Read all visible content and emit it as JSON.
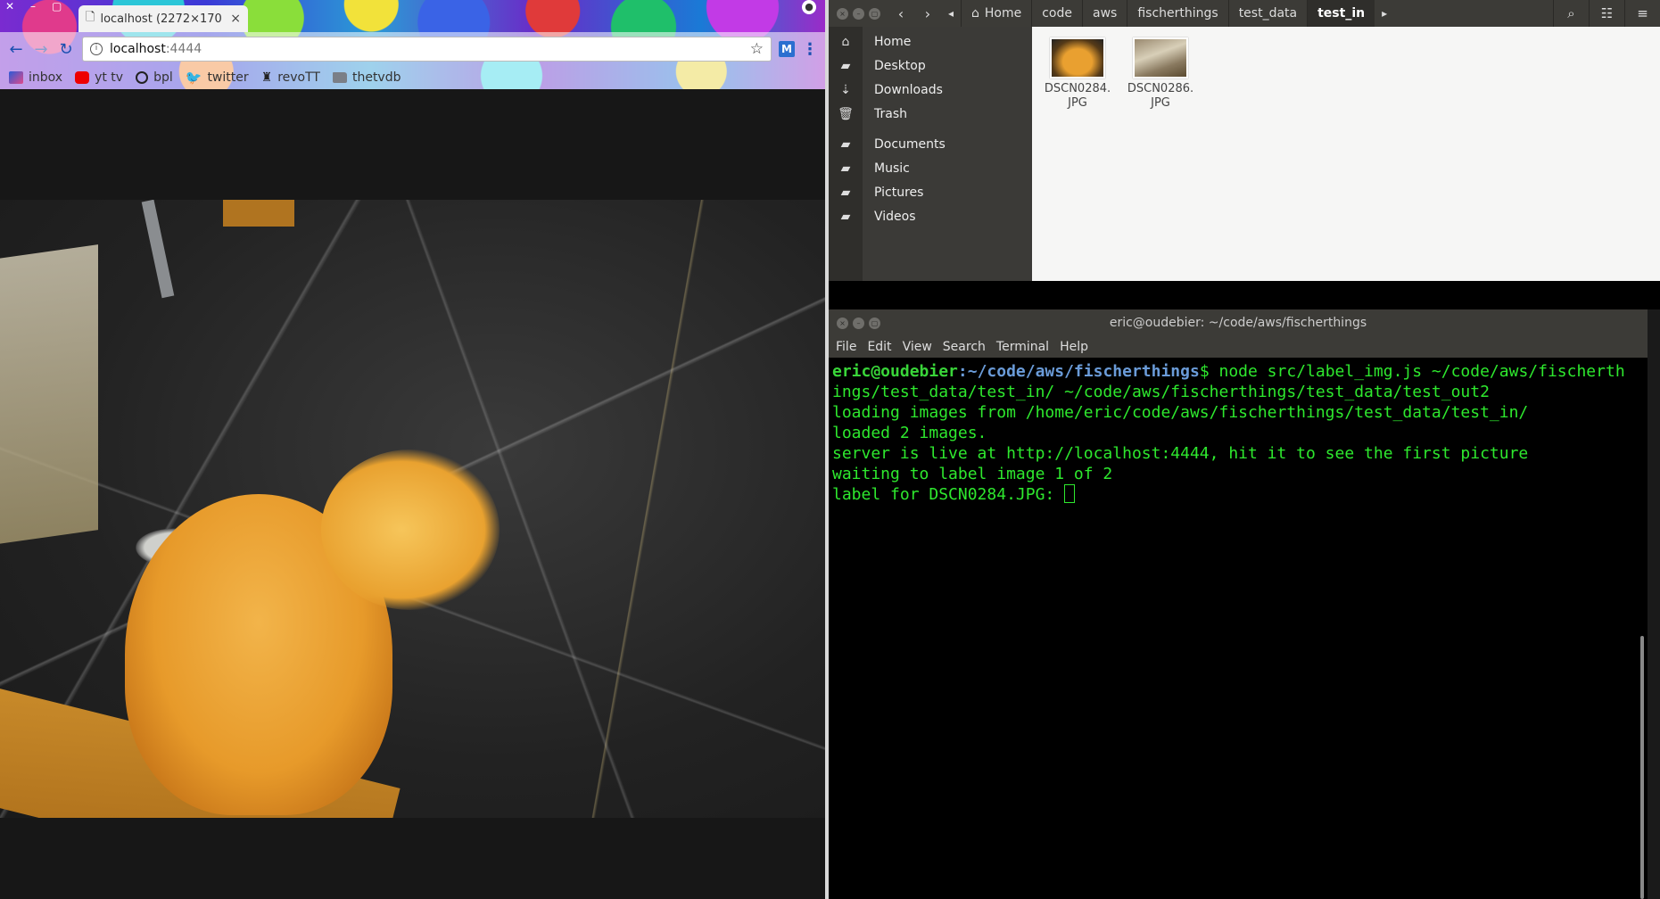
{
  "chrome": {
    "tab_title": "localhost (2272×170",
    "tab_close": "×",
    "url_host": "localhost",
    "url_port": ":4444",
    "extension_letter": "M",
    "bookmarks": [
      {
        "label": "inbox",
        "icon": "inbox-icon"
      },
      {
        "label": "yt tv",
        "icon": "youtube-icon"
      },
      {
        "label": "bpl",
        "icon": "circle-icon"
      },
      {
        "label": "twitter",
        "icon": "twitter-bird-icon"
      },
      {
        "label": "revoTT",
        "icon": "robot-icon"
      },
      {
        "label": "thetvdb",
        "icon": "folder-icon"
      }
    ]
  },
  "files": {
    "breadcrumbs": [
      "Home",
      "code",
      "aws",
      "fischerthings",
      "test_data",
      "test_in"
    ],
    "sidebar": [
      {
        "label": "Home",
        "icon": "home-icon"
      },
      {
        "label": "Desktop",
        "icon": "folder-icon"
      },
      {
        "label": "Downloads",
        "icon": "download-icon"
      },
      {
        "label": "Trash",
        "icon": "trash-icon"
      },
      {
        "label": "Documents",
        "icon": "folder-icon"
      },
      {
        "label": "Music",
        "icon": "folder-icon"
      },
      {
        "label": "Pictures",
        "icon": "folder-icon"
      },
      {
        "label": "Videos",
        "icon": "folder-icon"
      }
    ],
    "items": [
      {
        "name_line1": "DSCN0284.",
        "name_line2": "JPG"
      },
      {
        "name_line1": "DSCN0286.",
        "name_line2": "JPG"
      }
    ]
  },
  "terminal": {
    "title": "eric@oudebier: ~/code/aws/fischerthings",
    "menu": [
      "File",
      "Edit",
      "View",
      "Search",
      "Terminal",
      "Help"
    ],
    "prompt_user": "eric@oudebier",
    "prompt_path": ":~/code/aws/fischerthings",
    "prompt_cmd_line1": "$ node src/label_img.js ~/code/aws/fischerth",
    "lines": [
      "ings/test_data/test_in/ ~/code/aws/fischerthings/test_data/test_out2",
      "loading images from /home/eric/code/aws/fischerthings/test_data/test_in/",
      "loaded 2 images.",
      "server is live at http://localhost:4444, hit it to see the first picture",
      "waiting to label image 1 of 2"
    ],
    "last_line": "label for DSCN0284.JPG: "
  }
}
